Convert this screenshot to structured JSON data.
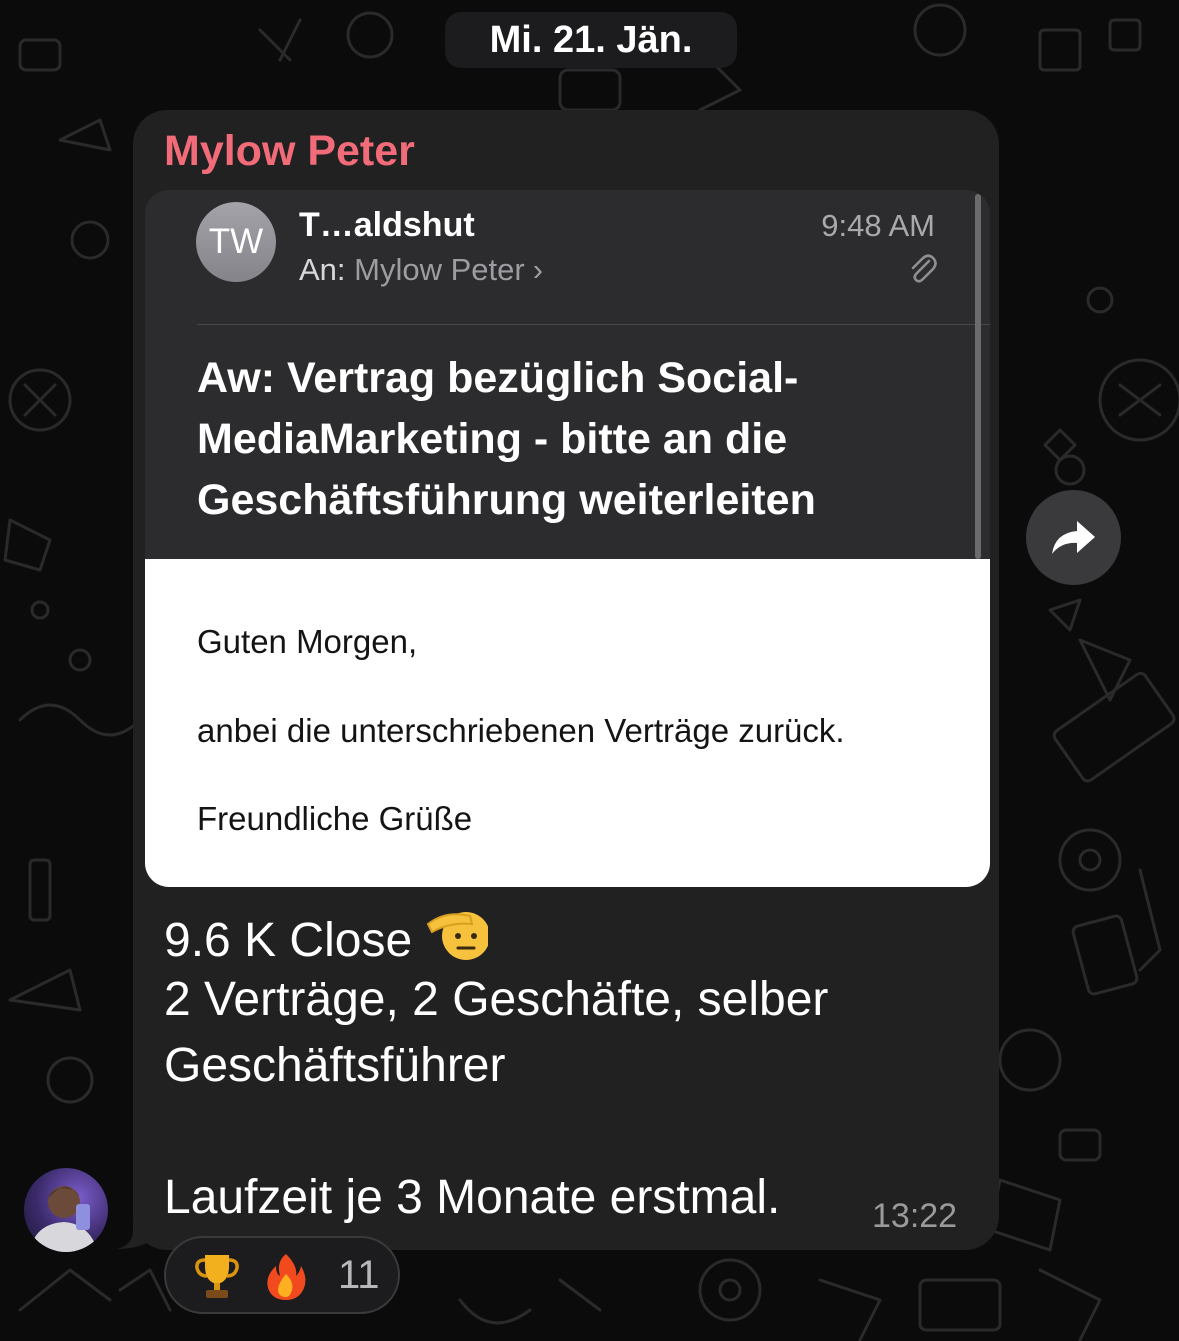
{
  "date_divider": "Mi. 21. Jän.",
  "message": {
    "sender": "Mylow Peter",
    "email_preview": {
      "avatar_initials": "TW",
      "from": "T…aldshut",
      "time": "9:48 AM",
      "to_label": "An:",
      "to_name": "Mylow Peter",
      "to_chevron": "›",
      "subject": "Aw: Vertrag bezüglich Social-MediaMarketing - bitte an die Geschäftsführung weiterleiten",
      "body": {
        "greeting": "Guten Morgen,",
        "text": "anbei die unterschriebenen Verträge zurück.",
        "closing": "Freundliche Grüße"
      }
    },
    "text_lines": [
      "9.6 K Close",
      "2 Verträge, 2 Geschäfte, selber",
      "Geschäftsführer",
      "Laufzeit je 3 Monate erstmal."
    ],
    "time": "13:22",
    "reactions": {
      "emojis": [
        "trophy-emoji",
        "fire-emoji"
      ],
      "count": "11"
    }
  },
  "colors": {
    "sender_name": "#f26b78",
    "bubble": "#212121",
    "background": "#0b0b0b"
  }
}
